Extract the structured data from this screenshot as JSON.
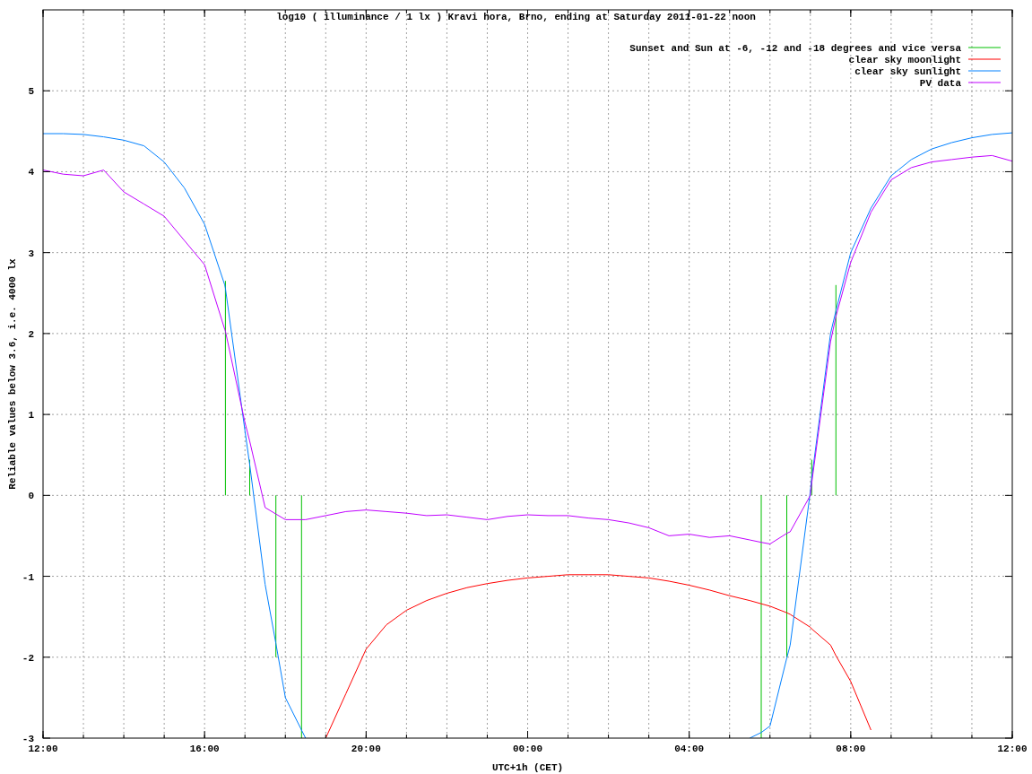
{
  "chart_data": {
    "type": "line",
    "title": "log10 ( illuminance / 1 lx ) Kravi hora, Brno, ending at Saturday 2011-01-22 noon",
    "xlabel": "UTC+1h (CET)",
    "ylabel": "Reliable values below 3.6, i.e. 4000 lx",
    "xlim": [
      "2011-01-21T12:00",
      "2011-01-22T12:00"
    ],
    "ylim": [
      -3,
      6
    ],
    "grid": true,
    "legend": true,
    "xticks": [
      {
        "value": "2011-01-21T12:00",
        "label": "12:00"
      },
      {
        "value": "2011-01-21T16:00",
        "label": "16:00"
      },
      {
        "value": "2011-01-21T20:00",
        "label": "20:00"
      },
      {
        "value": "2011-01-22T00:00",
        "label": "00:00"
      },
      {
        "value": "2011-01-22T04:00",
        "label": "04:00"
      },
      {
        "value": "2011-01-22T08:00",
        "label": "08:00"
      },
      {
        "value": "2011-01-22T12:00",
        "label": "12:00"
      }
    ],
    "yticks": [
      -3,
      -2,
      -1,
      0,
      1,
      2,
      3,
      4,
      5
    ],
    "x": [
      "2011-01-21T12:00",
      "2011-01-21T12:30",
      "2011-01-21T13:00",
      "2011-01-21T13:30",
      "2011-01-21T14:00",
      "2011-01-21T14:30",
      "2011-01-21T15:00",
      "2011-01-21T15:30",
      "2011-01-21T16:00",
      "2011-01-21T16:30",
      "2011-01-21T16:31",
      "2011-01-21T16:31",
      "2011-01-21T17:00",
      "2011-01-21T17:07",
      "2011-01-21T17:07",
      "2011-01-21T17:30",
      "2011-01-21T17:46",
      "2011-01-21T17:46",
      "2011-01-21T18:00",
      "2011-01-21T18:24",
      "2011-01-21T18:24",
      "2011-01-21T18:30",
      "2011-01-21T19:00",
      "2011-01-21T19:30",
      "2011-01-21T20:00",
      "2011-01-21T20:30",
      "2011-01-21T21:00",
      "2011-01-21T21:30",
      "2011-01-21T22:00",
      "2011-01-21T22:30",
      "2011-01-21T23:00",
      "2011-01-21T23:30",
      "2011-01-22T00:00",
      "2011-01-22T00:30",
      "2011-01-22T01:00",
      "2011-01-22T01:30",
      "2011-01-22T02:00",
      "2011-01-22T02:30",
      "2011-01-22T03:00",
      "2011-01-22T03:30",
      "2011-01-22T04:00",
      "2011-01-22T04:30",
      "2011-01-22T05:00",
      "2011-01-22T05:30",
      "2011-01-22T05:47",
      "2011-01-22T05:47",
      "2011-01-22T06:00",
      "2011-01-22T06:25",
      "2011-01-22T06:25",
      "2011-01-22T06:30",
      "2011-01-22T07:00",
      "2011-01-22T07:02",
      "2011-01-22T07:02",
      "2011-01-22T07:30",
      "2011-01-22T07:38",
      "2011-01-22T07:38",
      "2011-01-22T08:00",
      "2011-01-22T08:30",
      "2011-01-22T09:00",
      "2011-01-22T09:30",
      "2011-01-22T10:00",
      "2011-01-22T10:30",
      "2011-01-22T11:00",
      "2011-01-22T11:30",
      "2011-01-22T12:00"
    ],
    "series": [
      {
        "name": "Sunset and Sun at -6, -12 and -18 degrees and vice versa",
        "color": "#00c000",
        "values": [
          null,
          null,
          null,
          null,
          null,
          null,
          null,
          null,
          null,
          null,
          0,
          2.65,
          null,
          0,
          0.44,
          null,
          0,
          -2.0,
          null,
          0,
          -3,
          null,
          null,
          null,
          null,
          null,
          null,
          null,
          null,
          null,
          null,
          null,
          null,
          null,
          null,
          null,
          null,
          null,
          null,
          null,
          null,
          null,
          null,
          null,
          0,
          -3,
          null,
          0,
          -2.0,
          null,
          null,
          0,
          0.44,
          null,
          0,
          2.6,
          null,
          null,
          null,
          null,
          null,
          null,
          null,
          null,
          null
        ]
      },
      {
        "name": "clear sky moonlight",
        "color": "#ff0000",
        "values": [
          null,
          null,
          null,
          null,
          null,
          null,
          null,
          null,
          null,
          null,
          null,
          null,
          null,
          null,
          null,
          null,
          null,
          null,
          null,
          null,
          null,
          null,
          -3.0,
          -2.45,
          -1.9,
          -1.6,
          -1.42,
          -1.3,
          -1.21,
          -1.14,
          -1.09,
          -1.05,
          -1.02,
          -1.0,
          -0.98,
          -0.98,
          -0.98,
          -1.0,
          -1.02,
          -1.06,
          -1.11,
          -1.17,
          -1.24,
          -1.3,
          -1.34,
          -1.34,
          -1.37,
          -1.45,
          -1.45,
          -1.47,
          -1.63,
          -1.65,
          -1.65,
          -1.85,
          -1.98,
          -1.98,
          -2.3,
          -2.9,
          null,
          null,
          null,
          null,
          null,
          null,
          null
        ]
      },
      {
        "name": "clear sky sunlight",
        "color": "#0080ff",
        "values": [
          4.47,
          4.47,
          4.46,
          4.43,
          4.39,
          4.32,
          4.12,
          3.8,
          3.35,
          2.6,
          2.56,
          2.56,
          0.8,
          0.38,
          0.38,
          -1.1,
          -1.83,
          -1.83,
          -2.5,
          -2.9,
          -2.9,
          -3.0,
          null,
          null,
          null,
          null,
          null,
          null,
          null,
          null,
          null,
          null,
          null,
          null,
          null,
          null,
          null,
          null,
          null,
          null,
          null,
          null,
          null,
          -3.0,
          -2.93,
          -2.93,
          -2.85,
          -2.01,
          -2.01,
          -1.85,
          0.05,
          0.21,
          0.21,
          2.0,
          2.28,
          2.28,
          3.0,
          3.55,
          3.95,
          4.15,
          4.28,
          4.36,
          4.42,
          4.46,
          4.48
        ]
      },
      {
        "name": "PV data",
        "color": "#c000ff",
        "values": [
          4.02,
          3.97,
          3.95,
          4.02,
          3.75,
          3.6,
          3.45,
          3.15,
          2.85,
          2.05,
          2.03,
          2.03,
          0.9,
          0.67,
          0.67,
          -0.15,
          -0.23,
          -0.23,
          -0.3,
          -0.3,
          -0.3,
          -0.3,
          -0.25,
          -0.2,
          -0.18,
          -0.2,
          -0.22,
          -0.25,
          -0.24,
          -0.27,
          -0.3,
          -0.26,
          -0.24,
          -0.25,
          -0.25,
          -0.28,
          -0.3,
          -0.34,
          -0.4,
          -0.5,
          -0.48,
          -0.52,
          -0.5,
          -0.55,
          -0.58,
          -0.58,
          -0.6,
          -0.47,
          -0.47,
          -0.45,
          0.0,
          0.15,
          0.15,
          1.9,
          2.21,
          2.21,
          2.88,
          3.5,
          3.9,
          4.05,
          4.12,
          4.15,
          4.18,
          4.2,
          4.13
        ]
      }
    ]
  }
}
